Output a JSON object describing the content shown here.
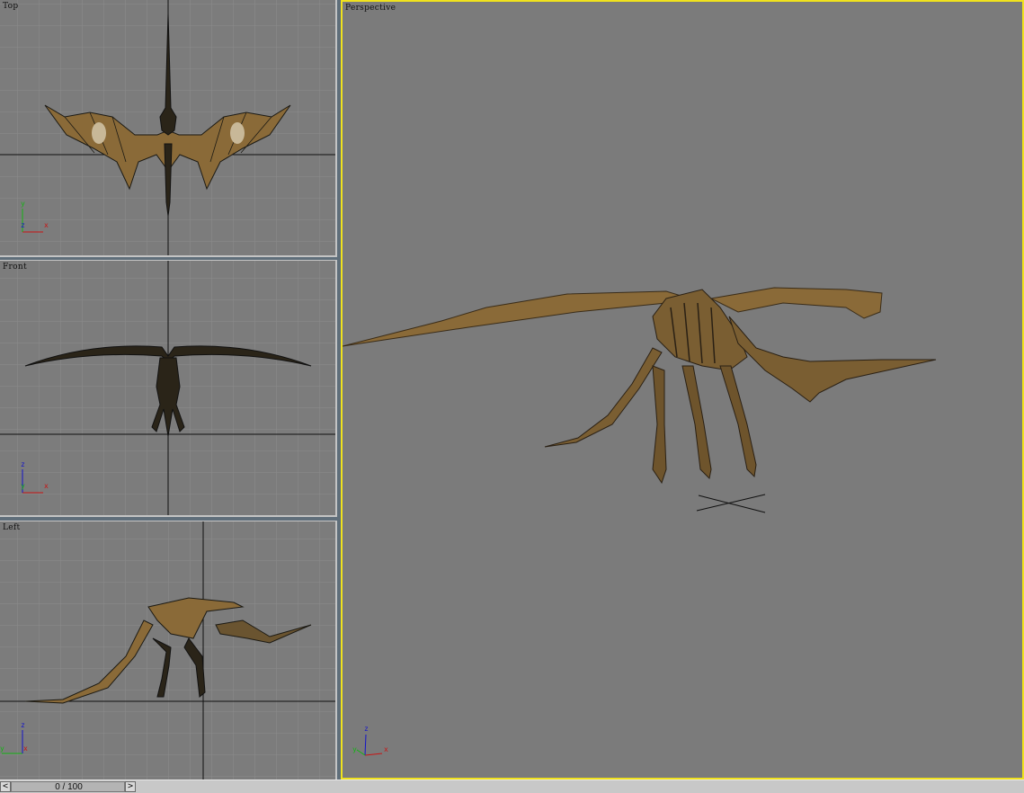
{
  "viewports": {
    "top": {
      "label": "Top",
      "axis_x": "x",
      "axis_y": "y",
      "axis_z": "z"
    },
    "front": {
      "label": "Front",
      "axis_x": "x",
      "axis_y": "y",
      "axis_z": "z"
    },
    "left": {
      "label": "Left",
      "axis_x": "x",
      "axis_y": "y",
      "axis_z": "z"
    },
    "perspective": {
      "label": "Perspective",
      "axis_x": "x",
      "axis_y": "y",
      "axis_z": "z",
      "active": true
    }
  },
  "timeline": {
    "frame_display": "0 / 100",
    "prev_glyph": "<",
    "next_glyph": ">"
  },
  "colors": {
    "viewport_bg": "#7c7c7c",
    "grid": "#8a8a8a",
    "active_border": "#f0e21e",
    "axis_x": "#c81414",
    "axis_y": "#14b414",
    "axis_z": "#1414c8",
    "model": "#8a6a38",
    "wire": "#1c1a14"
  }
}
